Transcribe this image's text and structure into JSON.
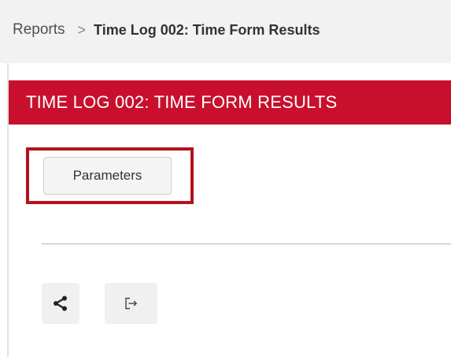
{
  "breadcrumb": {
    "root": "Reports",
    "separator": ">",
    "current": "Time Log 002: Time Form Results"
  },
  "header": {
    "title": "TIME LOG 002: TIME FORM RESULTS"
  },
  "toolbar": {
    "parameters_label": "Parameters"
  },
  "actions": {
    "share_icon": "share-icon",
    "export_icon": "export-icon"
  },
  "colors": {
    "title_bar": "#c8102e",
    "highlight": "#b5121b",
    "breadcrumb_bg": "#f2f2f2"
  }
}
